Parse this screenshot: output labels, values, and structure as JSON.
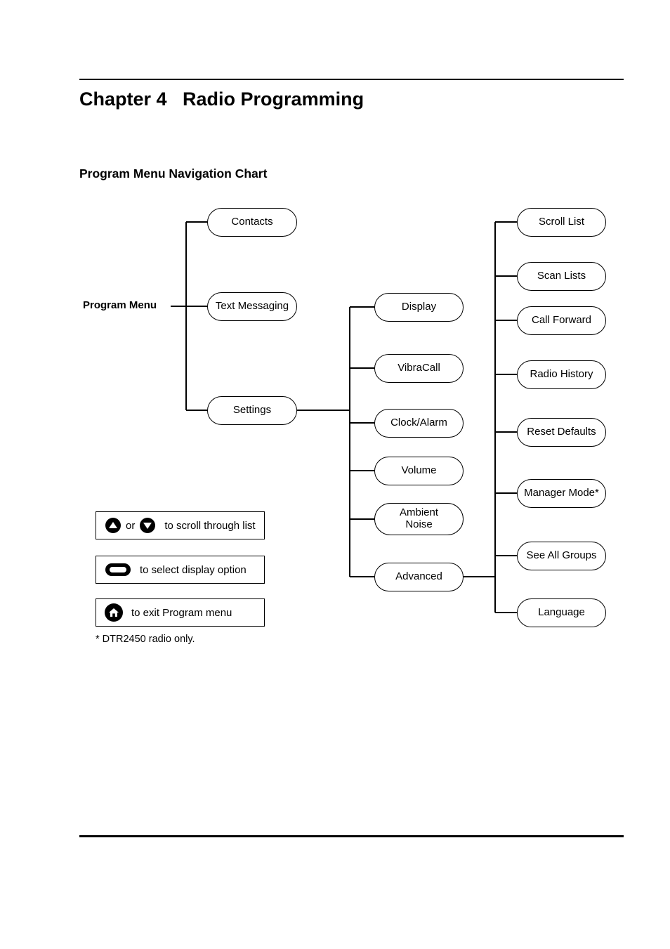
{
  "document": {
    "chapter_title": "Chapter 4   Radio Programming",
    "section_title": "Program Menu Navigation Chart",
    "footnote": "* DTR2450 radio only."
  },
  "diagram": {
    "root_label": "Program Menu",
    "level1": [
      {
        "label": "Contacts"
      },
      {
        "label": "Text Messaging"
      },
      {
        "label": "Settings"
      }
    ],
    "level2": [
      {
        "label": "Display"
      },
      {
        "label": "VibraCall"
      },
      {
        "label": "Clock/Alarm"
      },
      {
        "label": "Volume"
      },
      {
        "label": "Ambient\nNoise"
      },
      {
        "label": "Advanced"
      }
    ],
    "level3": [
      {
        "label": "Scroll List"
      },
      {
        "label": "Scan Lists"
      },
      {
        "label": "Call Forward"
      },
      {
        "label": "Radio History"
      },
      {
        "label": "Reset Defaults"
      },
      {
        "label": "Manager Mode*"
      },
      {
        "label": "See All Groups"
      },
      {
        "label": "Language"
      }
    ]
  },
  "legend": [
    {
      "icons": [
        "up-arrow-button-icon",
        "down-arrow-button-icon"
      ],
      "conjunction": "or",
      "text": "to scroll through list"
    },
    {
      "icons": [
        "select-button-icon"
      ],
      "text": "to select display option"
    },
    {
      "icons": [
        "home-button-icon"
      ],
      "text": "to exit Program menu"
    }
  ],
  "colors": {
    "ink": "#000000",
    "paper": "#ffffff"
  }
}
